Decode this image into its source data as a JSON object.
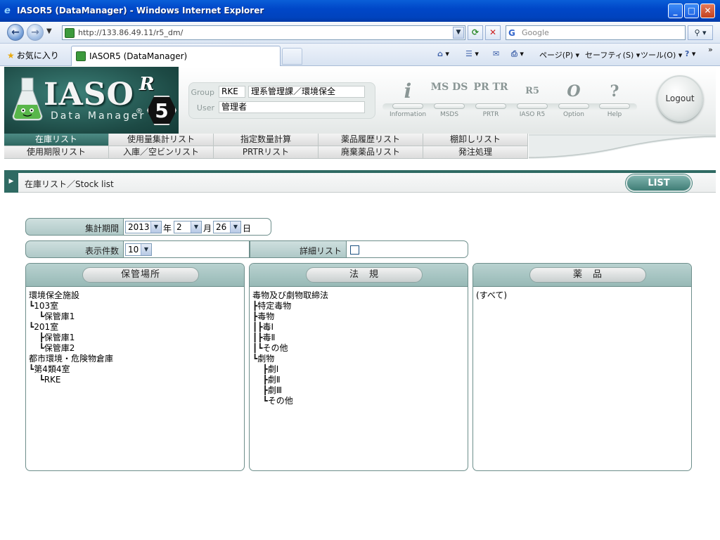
{
  "window": {
    "title": "IASOR5 (DataManager) - Windows Internet Explorer",
    "min_btn": "_",
    "max_btn": "□",
    "close_btn": "✕"
  },
  "browser": {
    "back_glyph": "←",
    "fwd_glyph": "→",
    "url": "http://133.86.49.11/r5_dm/",
    "search_placeholder": "Google",
    "favorites_label": "お気に入り",
    "tab_title": "IASOR5 (DataManager)",
    "commands": [
      {
        "icon": "⌂",
        "label": "▾"
      },
      {
        "icon": "☰",
        "label": "▾"
      },
      {
        "icon": "✉",
        "label": ""
      },
      {
        "icon": "⎙",
        "label": "▾"
      },
      {
        "icon": "",
        "label": "ページ(P) ▾"
      },
      {
        "icon": "",
        "label": "セーフティ(S) ▾"
      },
      {
        "icon": "",
        "label": "ツール(O) ▾"
      },
      {
        "icon": "?",
        "label": "▾"
      }
    ],
    "chevron": "»"
  },
  "header": {
    "logo_text": "IASO",
    "logo_reg": "®",
    "logo_sub": "Data Manager",
    "logo_r": "R",
    "logo_5": "5",
    "group_label": "Group",
    "group_code": "RKE",
    "group_name": "理系管理課／環境保全",
    "user_label": "User",
    "user_name": "管理者",
    "logout_label": "Logout",
    "tools": [
      {
        "glyph": "i",
        "label": "Information"
      },
      {
        "glyph": "MS DS",
        "label": "MSDS"
      },
      {
        "glyph": "PR TR",
        "label": "PRTR"
      },
      {
        "glyph": "R5",
        "label": "IASO R5"
      },
      {
        "glyph": "O",
        "label": "Option"
      },
      {
        "glyph": "?",
        "label": "Help"
      }
    ]
  },
  "menu": {
    "row1": [
      "在庫リスト",
      "使用量集計リスト",
      "指定数量計算",
      "薬品履歴リスト",
      "棚卸しリスト"
    ],
    "row2": [
      "使用期限リスト",
      "入庫／空ビンリスト",
      "PRTRリスト",
      "廃棄薬品リスト",
      "発注処理"
    ]
  },
  "breadcrumb": {
    "arrow": "▶",
    "text": "在庫リスト／Stock list",
    "list_button": "LIST"
  },
  "filters": {
    "period_label": "集計期間",
    "year": "2013",
    "year_unit": "年",
    "month": "2",
    "month_unit": "月",
    "day": "26",
    "day_unit": "日",
    "count_label": "表示件数",
    "count": "10",
    "detail_label": "詳細リスト",
    "dropdown_glyph": "▼"
  },
  "panels": {
    "storage": {
      "title": "保管場所",
      "lines": [
        {
          "prefix": "",
          "text": "環境保全施設"
        },
        {
          "prefix": "┗",
          "text": "103室"
        },
        {
          "prefix": "  ┗",
          "text": "保管庫1"
        },
        {
          "prefix": "┗",
          "text": "201室"
        },
        {
          "prefix": "  ┣",
          "text": "保管庫1"
        },
        {
          "prefix": "  ┗",
          "text": "保管庫2"
        },
        {
          "prefix": "",
          "text": "都市環境・危険物倉庫"
        },
        {
          "prefix": "┗",
          "text": "第4類4室"
        },
        {
          "prefix": "  ┗",
          "text": "RKE"
        }
      ]
    },
    "law": {
      "title": "法　規",
      "lines": [
        {
          "prefix": "",
          "text": "毒物及び劇物取締法"
        },
        {
          "prefix": "┣",
          "text": "特定毒物"
        },
        {
          "prefix": "┣",
          "text": "毒物"
        },
        {
          "prefix": "┃┣",
          "text": "毒Ⅰ"
        },
        {
          "prefix": "┃┣",
          "text": "毒Ⅱ"
        },
        {
          "prefix": "┃┗",
          "text": "その他"
        },
        {
          "prefix": "┗",
          "text": "劇物"
        },
        {
          "prefix": "  ┣",
          "text": "劇Ⅰ"
        },
        {
          "prefix": "  ┣",
          "text": "劇Ⅱ"
        },
        {
          "prefix": "  ┣",
          "text": "劇Ⅲ"
        },
        {
          "prefix": "  ┗",
          "text": "その他"
        }
      ]
    },
    "chemical": {
      "title": "薬　品",
      "lines": [
        {
          "prefix": "",
          "text": "(すべて)"
        }
      ]
    }
  }
}
